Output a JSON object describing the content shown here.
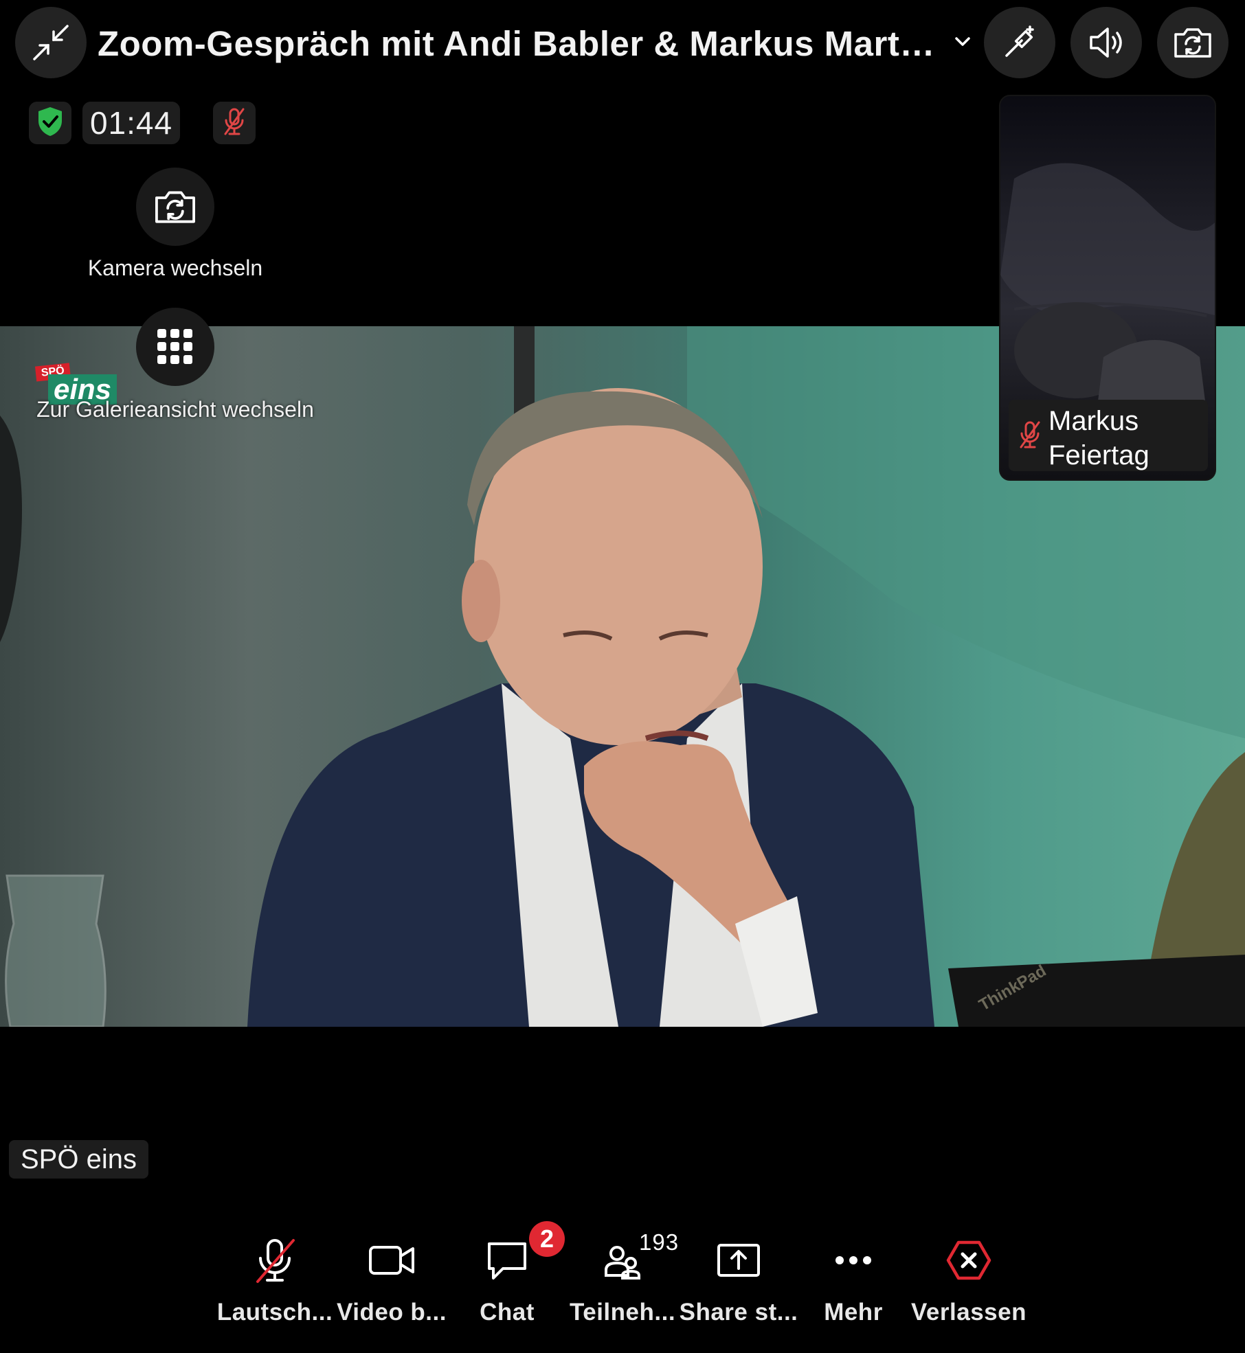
{
  "header": {
    "title": "Zoom-Gespräch mit Andi Babler & Markus Marte...",
    "minimize_icon": "minimize-arrows-icon",
    "title_dropdown_icon": "chevron-down-icon",
    "annotate_icon": "magic-wand-icon",
    "speaker_icon": "speaker-icon",
    "switch_camera_icon": "camera-rotate-icon"
  },
  "status": {
    "encryption_icon": "shield-check-icon",
    "timer": "01:44",
    "mic_icon": "mic-muted-icon"
  },
  "overlays": {
    "switch_camera_label": "Kamera wechseln",
    "gallery_view_label": "Zur Galerieansicht wechseln"
  },
  "thumbnail": {
    "name": "Markus Feiertag",
    "mic_icon": "mic-muted-icon"
  },
  "main_video": {
    "source_label": "SPÖ eins",
    "logo_text_top": "SPÖ",
    "logo_text": "eins",
    "laptop_text": "ThinkPad"
  },
  "toolbar": {
    "items": [
      {
        "label": "Lautsch...",
        "icon": "mic-muted-icon"
      },
      {
        "label": "Video b...",
        "icon": "video-camera-icon"
      },
      {
        "label": "Chat",
        "icon": "chat-bubble-icon",
        "badge": "2"
      },
      {
        "label": "Teilneh...",
        "icon": "participants-icon",
        "count": "193"
      },
      {
        "label": "Share st...",
        "icon": "share-screen-icon"
      },
      {
        "label": "Mehr",
        "icon": "more-dots-icon"
      },
      {
        "label": "Verlassen",
        "icon": "leave-icon"
      }
    ]
  },
  "colors": {
    "danger": "#e02832",
    "secure_green": "#2fb84f",
    "muted_red": "#e04646",
    "background": "#000000"
  }
}
